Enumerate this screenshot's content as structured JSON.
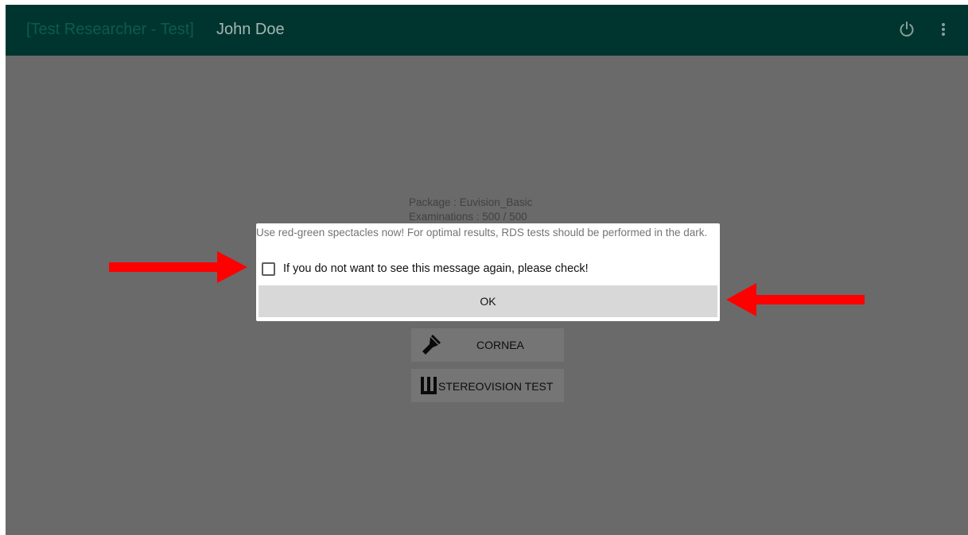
{
  "appbar": {
    "title_prefix": "[Test Researcher  - Test]",
    "title_name": "John Doe",
    "background": "#00352f",
    "icons": [
      "power-icon",
      "more-vert-icon"
    ]
  },
  "info": {
    "package": "Package : Euvision_Basic",
    "examinations": "Examinations : 500 / 500"
  },
  "tests": [
    {
      "label": "CORNEA",
      "icon": "flashlight-icon"
    },
    {
      "label": "STEREOVISION TEST",
      "icon": "stereovision-icon"
    }
  ],
  "dialog": {
    "message": "Use red-green spectacles now! For optimal results, RDS tests should be performed in the dark.",
    "checkbox_label": "If you do not want to see this message again, please check!",
    "checkbox_checked": false,
    "ok_label": "OK"
  },
  "annotations": {
    "arrow_color": "#ff0000",
    "arrows": [
      "arrow-pointing-right-at-checkbox",
      "arrow-pointing-left-at-ok-button"
    ]
  }
}
